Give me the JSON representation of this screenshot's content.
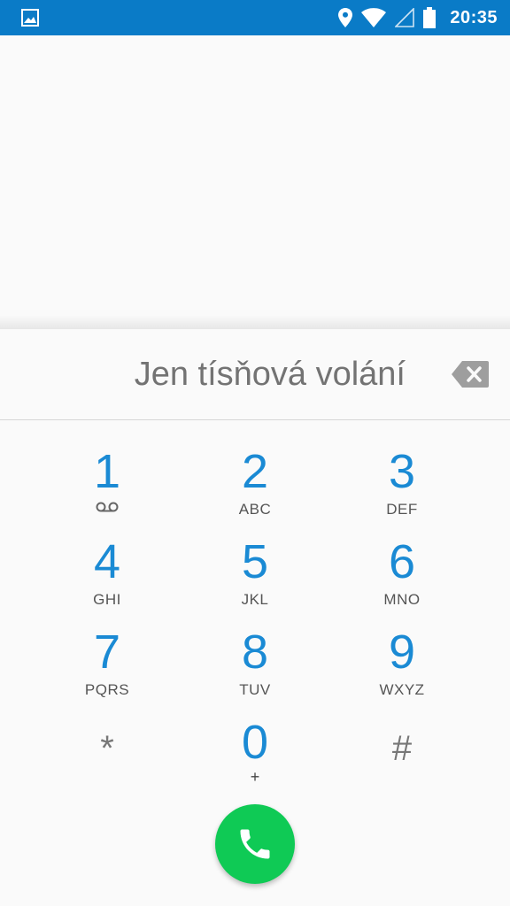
{
  "status_bar": {
    "time": "20:35",
    "icons": [
      "image-icon",
      "location-icon",
      "wifi-icon",
      "signal-icon",
      "battery-icon"
    ]
  },
  "dialer": {
    "hint": "Jen tísňová volání",
    "keys": [
      {
        "digit": "1",
        "letters": ""
      },
      {
        "digit": "2",
        "letters": "ABC"
      },
      {
        "digit": "3",
        "letters": "DEF"
      },
      {
        "digit": "4",
        "letters": "GHI"
      },
      {
        "digit": "5",
        "letters": "JKL"
      },
      {
        "digit": "6",
        "letters": "MNO"
      },
      {
        "digit": "7",
        "letters": "PQRS"
      },
      {
        "digit": "8",
        "letters": "TUV"
      },
      {
        "digit": "9",
        "letters": "WXYZ"
      },
      {
        "digit": "*",
        "letters": ""
      },
      {
        "digit": "0",
        "letters": "+"
      },
      {
        "digit": "#",
        "letters": ""
      }
    ]
  },
  "colors": {
    "status_bar": "#0a7bc7",
    "digit": "#1a8ad4",
    "call_button": "#0fca55"
  }
}
